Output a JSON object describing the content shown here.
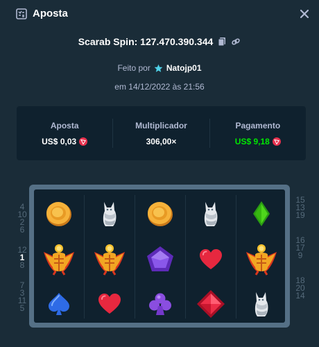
{
  "header": {
    "title": "Aposta",
    "icon": "bet-slip-icon",
    "close_icon": "close-icon"
  },
  "spin": {
    "label": "Scarab Spin: 127.470.390.344",
    "copy_icon": "copy-icon",
    "link_icon": "link-icon"
  },
  "made_by": {
    "prefix": "Feito por",
    "badge_icon": "vip-star-icon",
    "user": "Natojp01"
  },
  "date": "em 14/12/2022 às 21:56",
  "stats": {
    "bet_label": "Aposta",
    "bet_value": "US$ 0,03",
    "multiplier_label": "Multiplicador",
    "multiplier_value": "306,00×",
    "payout_label": "Pagamento",
    "payout_value": "US$ 9,18",
    "currency_icon": "trx-coin-icon",
    "win_color": "#00e701"
  },
  "grid": [
    [
      "coin",
      "cat",
      "coin",
      "cat",
      "diamond"
    ],
    [
      "scarab",
      "scarab",
      "gem",
      "heart",
      "scarab"
    ],
    [
      "spade",
      "heart",
      "club",
      "ruby",
      "cat"
    ]
  ],
  "paylines": {
    "left": [
      [
        "4",
        "10",
        "2",
        "6"
      ],
      [
        "12",
        "1",
        "8"
      ],
      [
        "7",
        "3",
        "11",
        "5"
      ]
    ],
    "right": [
      [
        "15",
        "13",
        "19"
      ],
      [
        "16",
        "17",
        "9"
      ],
      [
        "18",
        "20",
        "14"
      ]
    ],
    "active": "1"
  },
  "colors": {
    "background": "#1a2c38",
    "panel": "#0f212e",
    "frame": "#557086",
    "muted_text": "#b1bad3"
  }
}
